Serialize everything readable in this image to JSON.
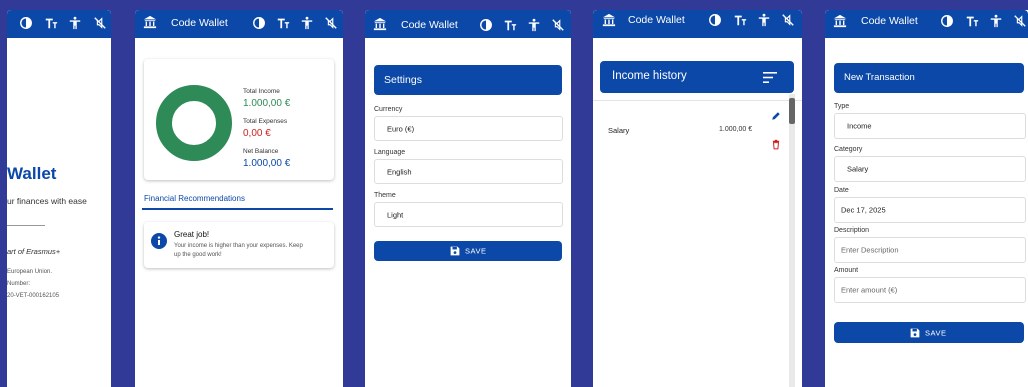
{
  "app": {
    "name": "Code Wallet"
  },
  "colors": {
    "background": "#323a98",
    "primary": "#0b48a7",
    "income": "#2e8b57",
    "expense": "#cc2222"
  },
  "icons": [
    "bank-icon",
    "contrast-icon",
    "text-size-icon",
    "accessibility-icon",
    "no-sound-icon",
    "menu-icon",
    "edit-icon",
    "delete-icon",
    "info-icon",
    "save-icon"
  ],
  "welcome": {
    "title": "Wallet",
    "subtitle": "ur finances with ease",
    "partner": "art of Erasmus+",
    "lines": [
      "European Union.",
      "Number:",
      "20-VET-000162105"
    ]
  },
  "dashboard": {
    "income_label": "Total Income",
    "income_value": "1.000,00 €",
    "expenses_label": "Total Expenses",
    "expenses_value": "0,00 €",
    "balance_label": "Net Balance",
    "balance_value": "1.000,00 €",
    "donut": {
      "income": 1000,
      "expenses": 0
    },
    "recommendations_title": "Financial Recommendations",
    "tip_title": "Great job!",
    "tip_text_1": "Your income is higher than your expenses. Keep",
    "tip_text_2": "up the good work!"
  },
  "settings": {
    "title": "Settings",
    "currency_label": "Currency",
    "currency_value": "Euro (€)",
    "language_label": "Language",
    "language_value": "English",
    "theme_label": "Theme",
    "theme_value": "Light",
    "save_label": "SAVE"
  },
  "history": {
    "title": "Income history",
    "items": [
      {
        "name": "Salary",
        "amount": "1.000,00 €"
      }
    ]
  },
  "transaction": {
    "title": "New Transaction",
    "type_label": "Type",
    "type_value": "Income",
    "category_label": "Category",
    "category_value": "Salary",
    "date_label": "Date",
    "date_value": "Dec 17, 2025",
    "description_label": "Description",
    "description_placeholder": "Enter Description",
    "amount_label": "Amount",
    "amount_placeholder": "Enter amount (€)",
    "save_label": "SAVE"
  }
}
